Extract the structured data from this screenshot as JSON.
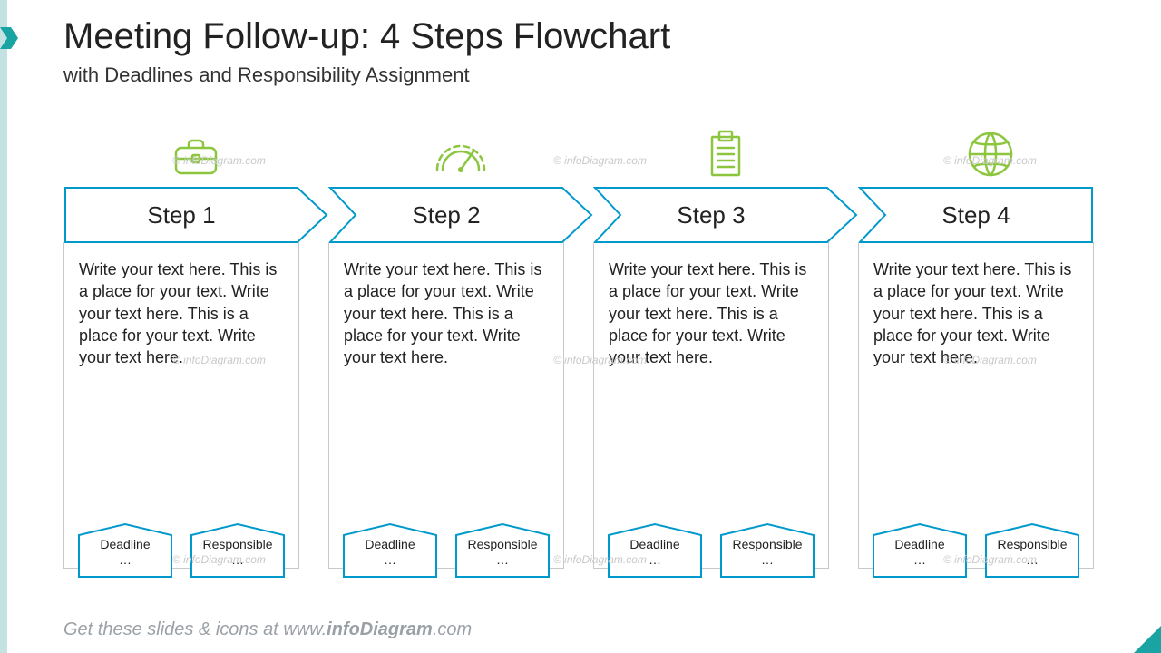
{
  "title": "Meeting Follow-up: 4 Steps Flowchart",
  "subtitle": "with Deadlines and Responsibility Assignment",
  "colors": {
    "accent": "#0099cc",
    "icon": "#8cc63f",
    "grey": "#c8c8c8"
  },
  "bodyText": "Write your text here. This is a place for your text. Write your text here. This is a place for your text. Write your text here.",
  "steps": [
    {
      "label": "Step 1",
      "icon": "briefcase-icon",
      "deadline": "Deadline",
      "responsible": "Responsible"
    },
    {
      "label": "Step 2",
      "icon": "gauge-icon",
      "deadline": "Deadline",
      "responsible": "Responsible"
    },
    {
      "label": "Step 3",
      "icon": "clipboard-icon",
      "deadline": "Deadline",
      "responsible": "Responsible"
    },
    {
      "label": "Step 4",
      "icon": "globe-icon",
      "deadline": "Deadline",
      "responsible": "Responsible"
    }
  ],
  "ellipsis": "…",
  "footer_prefix": "Get these slides & icons at www.",
  "footer_brand": "infoDiagram",
  "footer_suffix": ".com",
  "watermark": "© infoDiagram.com"
}
